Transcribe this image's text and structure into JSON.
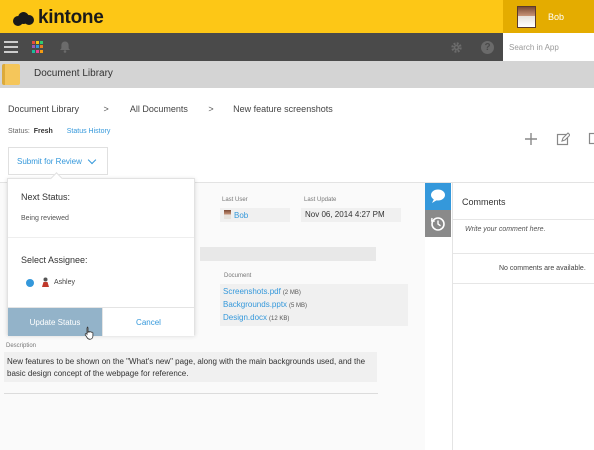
{
  "brand": {
    "name": "kintone",
    "color": "#fdc716"
  },
  "user": {
    "name": "Bob"
  },
  "toolbar": {
    "search_placeholder": "Search in App"
  },
  "app": {
    "title": "Document Library"
  },
  "breadcrumb": [
    {
      "label": "Document Library"
    },
    {
      "label": "All Documents"
    },
    {
      "label": "New feature screenshots"
    }
  ],
  "breadcrumb_sep": ">",
  "status": {
    "label": "Status:",
    "value": "Fresh",
    "history_link": "Status History"
  },
  "submit_button": "Submit for Review",
  "popup": {
    "next_status_label": "Next Status:",
    "next_status_value": "Being reviewed",
    "assignee_label": "Select Assignee:",
    "assignee_name": "Ashley",
    "update_button": "Update Status",
    "cancel_button": "Cancel"
  },
  "record": {
    "last_user_label": "Last User",
    "last_user_value": "Bob",
    "last_update_label": "Last Update",
    "last_update_value": "Nov 06, 2014 4:27 PM",
    "document_label": "Document",
    "documents": [
      {
        "name": "Screenshots.pdf",
        "size": "(2 MB)"
      },
      {
        "name": "Backgrounds.pptx",
        "size": "(5 MB)"
      },
      {
        "name": "Design.docx",
        "size": "(12 KB)"
      }
    ],
    "description_label": "Description",
    "description_text": "New features to be shown on the \"What's new\" page, along with the main backgrounds used, and the basic design concept of the webpage for reference."
  },
  "comments": {
    "title": "Comments",
    "placeholder": "Write your comment here.",
    "empty_text": "No comments are available."
  },
  "colors": {
    "accent": "#3498db",
    "toolbar": "#4a4a4a",
    "update_button": "#93b3c9"
  }
}
